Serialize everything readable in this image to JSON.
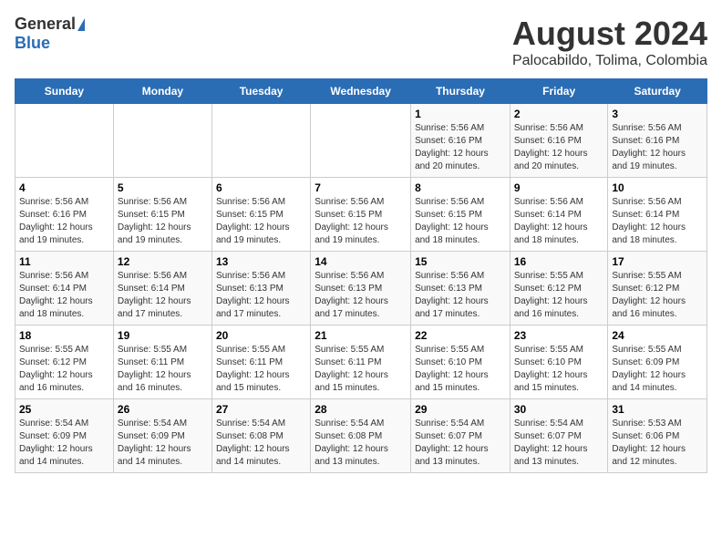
{
  "header": {
    "logo_general": "General",
    "logo_blue": "Blue",
    "main_title": "August 2024",
    "subtitle": "Palocabildo, Tolima, Colombia"
  },
  "calendar": {
    "days_of_week": [
      "Sunday",
      "Monday",
      "Tuesday",
      "Wednesday",
      "Thursday",
      "Friday",
      "Saturday"
    ],
    "weeks": [
      [
        {
          "day": "",
          "info": ""
        },
        {
          "day": "",
          "info": ""
        },
        {
          "day": "",
          "info": ""
        },
        {
          "day": "",
          "info": ""
        },
        {
          "day": "1",
          "info": "Sunrise: 5:56 AM\nSunset: 6:16 PM\nDaylight: 12 hours\nand 20 minutes."
        },
        {
          "day": "2",
          "info": "Sunrise: 5:56 AM\nSunset: 6:16 PM\nDaylight: 12 hours\nand 20 minutes."
        },
        {
          "day": "3",
          "info": "Sunrise: 5:56 AM\nSunset: 6:16 PM\nDaylight: 12 hours\nand 19 minutes."
        }
      ],
      [
        {
          "day": "4",
          "info": "Sunrise: 5:56 AM\nSunset: 6:16 PM\nDaylight: 12 hours\nand 19 minutes."
        },
        {
          "day": "5",
          "info": "Sunrise: 5:56 AM\nSunset: 6:15 PM\nDaylight: 12 hours\nand 19 minutes."
        },
        {
          "day": "6",
          "info": "Sunrise: 5:56 AM\nSunset: 6:15 PM\nDaylight: 12 hours\nand 19 minutes."
        },
        {
          "day": "7",
          "info": "Sunrise: 5:56 AM\nSunset: 6:15 PM\nDaylight: 12 hours\nand 19 minutes."
        },
        {
          "day": "8",
          "info": "Sunrise: 5:56 AM\nSunset: 6:15 PM\nDaylight: 12 hours\nand 18 minutes."
        },
        {
          "day": "9",
          "info": "Sunrise: 5:56 AM\nSunset: 6:14 PM\nDaylight: 12 hours\nand 18 minutes."
        },
        {
          "day": "10",
          "info": "Sunrise: 5:56 AM\nSunset: 6:14 PM\nDaylight: 12 hours\nand 18 minutes."
        }
      ],
      [
        {
          "day": "11",
          "info": "Sunrise: 5:56 AM\nSunset: 6:14 PM\nDaylight: 12 hours\nand 18 minutes."
        },
        {
          "day": "12",
          "info": "Sunrise: 5:56 AM\nSunset: 6:14 PM\nDaylight: 12 hours\nand 17 minutes."
        },
        {
          "day": "13",
          "info": "Sunrise: 5:56 AM\nSunset: 6:13 PM\nDaylight: 12 hours\nand 17 minutes."
        },
        {
          "day": "14",
          "info": "Sunrise: 5:56 AM\nSunset: 6:13 PM\nDaylight: 12 hours\nand 17 minutes."
        },
        {
          "day": "15",
          "info": "Sunrise: 5:56 AM\nSunset: 6:13 PM\nDaylight: 12 hours\nand 17 minutes."
        },
        {
          "day": "16",
          "info": "Sunrise: 5:55 AM\nSunset: 6:12 PM\nDaylight: 12 hours\nand 16 minutes."
        },
        {
          "day": "17",
          "info": "Sunrise: 5:55 AM\nSunset: 6:12 PM\nDaylight: 12 hours\nand 16 minutes."
        }
      ],
      [
        {
          "day": "18",
          "info": "Sunrise: 5:55 AM\nSunset: 6:12 PM\nDaylight: 12 hours\nand 16 minutes."
        },
        {
          "day": "19",
          "info": "Sunrise: 5:55 AM\nSunset: 6:11 PM\nDaylight: 12 hours\nand 16 minutes."
        },
        {
          "day": "20",
          "info": "Sunrise: 5:55 AM\nSunset: 6:11 PM\nDaylight: 12 hours\nand 15 minutes."
        },
        {
          "day": "21",
          "info": "Sunrise: 5:55 AM\nSunset: 6:11 PM\nDaylight: 12 hours\nand 15 minutes."
        },
        {
          "day": "22",
          "info": "Sunrise: 5:55 AM\nSunset: 6:10 PM\nDaylight: 12 hours\nand 15 minutes."
        },
        {
          "day": "23",
          "info": "Sunrise: 5:55 AM\nSunset: 6:10 PM\nDaylight: 12 hours\nand 15 minutes."
        },
        {
          "day": "24",
          "info": "Sunrise: 5:55 AM\nSunset: 6:09 PM\nDaylight: 12 hours\nand 14 minutes."
        }
      ],
      [
        {
          "day": "25",
          "info": "Sunrise: 5:54 AM\nSunset: 6:09 PM\nDaylight: 12 hours\nand 14 minutes."
        },
        {
          "day": "26",
          "info": "Sunrise: 5:54 AM\nSunset: 6:09 PM\nDaylight: 12 hours\nand 14 minutes."
        },
        {
          "day": "27",
          "info": "Sunrise: 5:54 AM\nSunset: 6:08 PM\nDaylight: 12 hours\nand 14 minutes."
        },
        {
          "day": "28",
          "info": "Sunrise: 5:54 AM\nSunset: 6:08 PM\nDaylight: 12 hours\nand 13 minutes."
        },
        {
          "day": "29",
          "info": "Sunrise: 5:54 AM\nSunset: 6:07 PM\nDaylight: 12 hours\nand 13 minutes."
        },
        {
          "day": "30",
          "info": "Sunrise: 5:54 AM\nSunset: 6:07 PM\nDaylight: 12 hours\nand 13 minutes."
        },
        {
          "day": "31",
          "info": "Sunrise: 5:53 AM\nSunset: 6:06 PM\nDaylight: 12 hours\nand 12 minutes."
        }
      ]
    ]
  }
}
